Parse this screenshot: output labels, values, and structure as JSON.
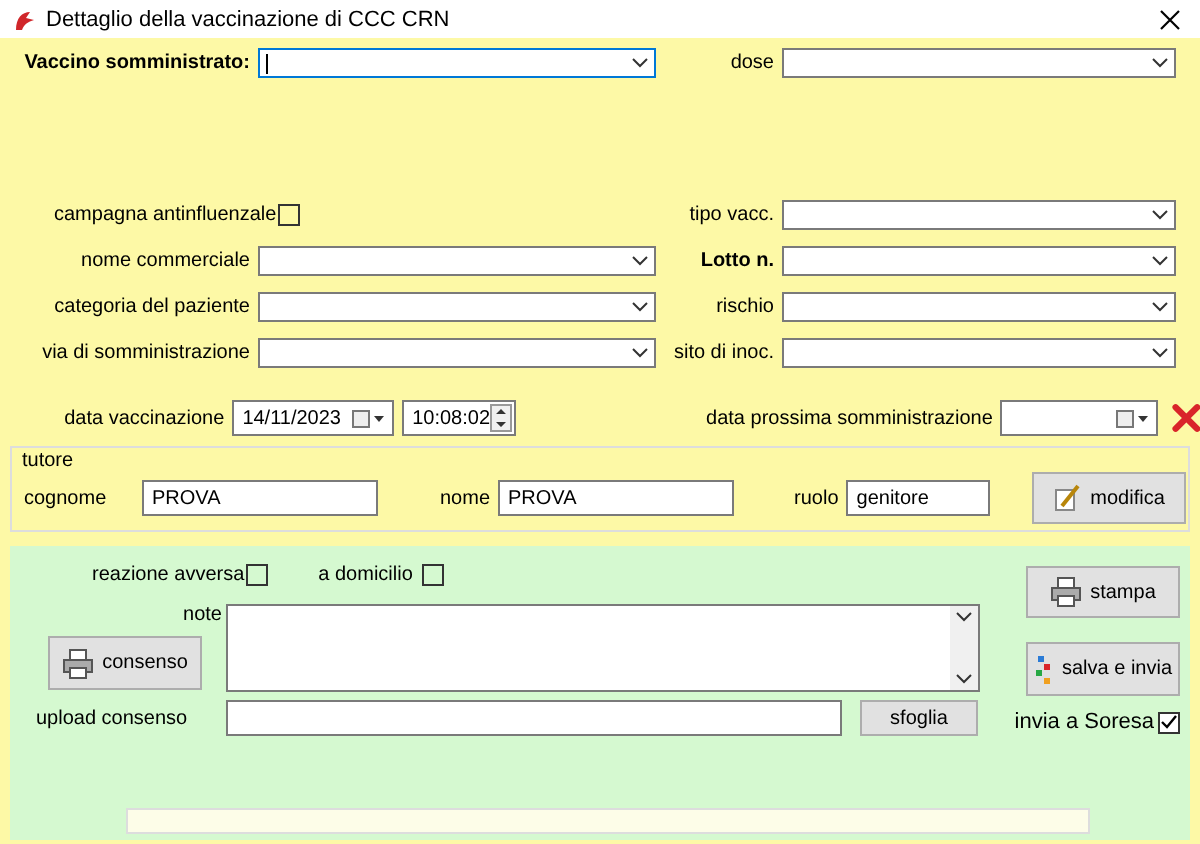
{
  "window": {
    "title": "Dettaglio della vaccinazione di CCC CRN"
  },
  "rows": [
    {
      "left": {
        "kind": "combo",
        "label": "Vaccino somministrato:",
        "bold": true,
        "focused": true
      },
      "right": {
        "kind": "combo",
        "label": "dose",
        "bold": false,
        "focused": false
      }
    },
    {
      "left": {
        "kind": "checkbox",
        "label": "campagna antinfluenzale",
        "bold": false,
        "checked": false
      },
      "right": {
        "kind": "combo",
        "label": "tipo vacc.",
        "bold": false,
        "focused": false
      }
    },
    {
      "left": {
        "kind": "combo",
        "label": "nome commerciale",
        "bold": false,
        "focused": false
      },
      "right": {
        "kind": "combo",
        "label": "Lotto n.",
        "bold": true,
        "focused": false
      }
    },
    {
      "left": {
        "kind": "combo",
        "label": "categoria del paziente",
        "bold": false,
        "focused": false
      },
      "right": {
        "kind": "combo",
        "label": "rischio",
        "bold": false,
        "focused": false
      }
    },
    {
      "left": {
        "kind": "combo",
        "label": "via di somministrazione",
        "bold": false,
        "focused": false
      },
      "right": {
        "kind": "combo",
        "label": "sito di inoc.",
        "bold": false,
        "focused": false
      }
    }
  ],
  "vaccination_date": {
    "label": "data vaccinazione",
    "date": "14/11/2023",
    "time": "10:08:02"
  },
  "next_date": {
    "label": "data prossima somministrazione"
  },
  "tutore": {
    "title": "tutore",
    "fields": [
      {
        "label": "cognome",
        "value": "PROVA"
      },
      {
        "label": "nome",
        "value": "PROVA"
      },
      {
        "label": "ruolo",
        "value": "genitore"
      }
    ],
    "button": "modifica"
  },
  "flags": [
    {
      "label": "reazione avversa",
      "checked": false
    },
    {
      "label": "a domicilio",
      "checked": false
    }
  ],
  "note": {
    "label": "note"
  },
  "consenso_button": "consenso",
  "upload": {
    "label": "upload consenso",
    "button": "sfoglia"
  },
  "stampa_button": "stampa",
  "salva_button": "salva e invia",
  "soresa": {
    "label": "invia a Soresa",
    "checked": true
  },
  "progress": {
    "level": 0
  }
}
